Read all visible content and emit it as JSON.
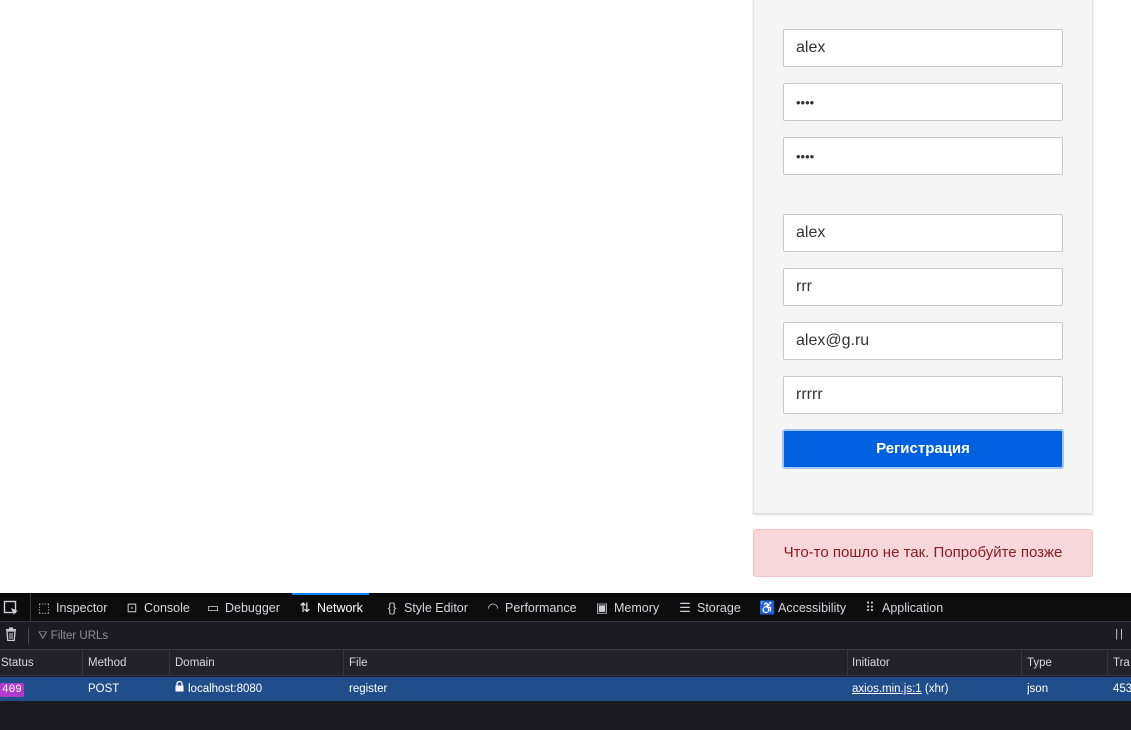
{
  "form": {
    "login_value": "alex",
    "password_value": "••••",
    "password_confirm_value": "••••",
    "name_value": "alex",
    "surname_value": "rrr",
    "email_value": "alex@g.ru",
    "extra_value": "rrrrr",
    "submit_label": "Регистрация"
  },
  "alert": {
    "message": "Что-то пошло не так. Попробуйте позже"
  },
  "devtools": {
    "tabs": [
      {
        "label": "Inspector",
        "icon": "inspector-icon"
      },
      {
        "label": "Console",
        "icon": "console-icon"
      },
      {
        "label": "Debugger",
        "icon": "debugger-icon"
      },
      {
        "label": "Network",
        "icon": "network-icon",
        "active": true
      },
      {
        "label": "Style Editor",
        "icon": "style-editor-icon"
      },
      {
        "label": "Performance",
        "icon": "performance-icon"
      },
      {
        "label": "Memory",
        "icon": "memory-icon"
      },
      {
        "label": "Storage",
        "icon": "storage-icon"
      },
      {
        "label": "Accessibility",
        "icon": "accessibility-icon"
      },
      {
        "label": "Application",
        "icon": "application-icon"
      }
    ],
    "filter_placeholder": "Filter URLs",
    "columns": [
      "Status",
      "Method",
      "Domain",
      "File",
      "Initiator",
      "Type",
      "Tra"
    ],
    "requests": [
      {
        "status": "409",
        "method": "POST",
        "domain": "localhost:8080",
        "file": "register",
        "initiator_link": "axios.min.js:1",
        "initiator_suffix": " (xhr)",
        "type": "json",
        "transferred": "453"
      }
    ]
  },
  "colors": {
    "accent": "#0060df",
    "alert_bg": "#f8d7da",
    "alert_text": "#8a1c24",
    "selected_row": "#204e8a",
    "status_badge": "#b33bcc"
  }
}
